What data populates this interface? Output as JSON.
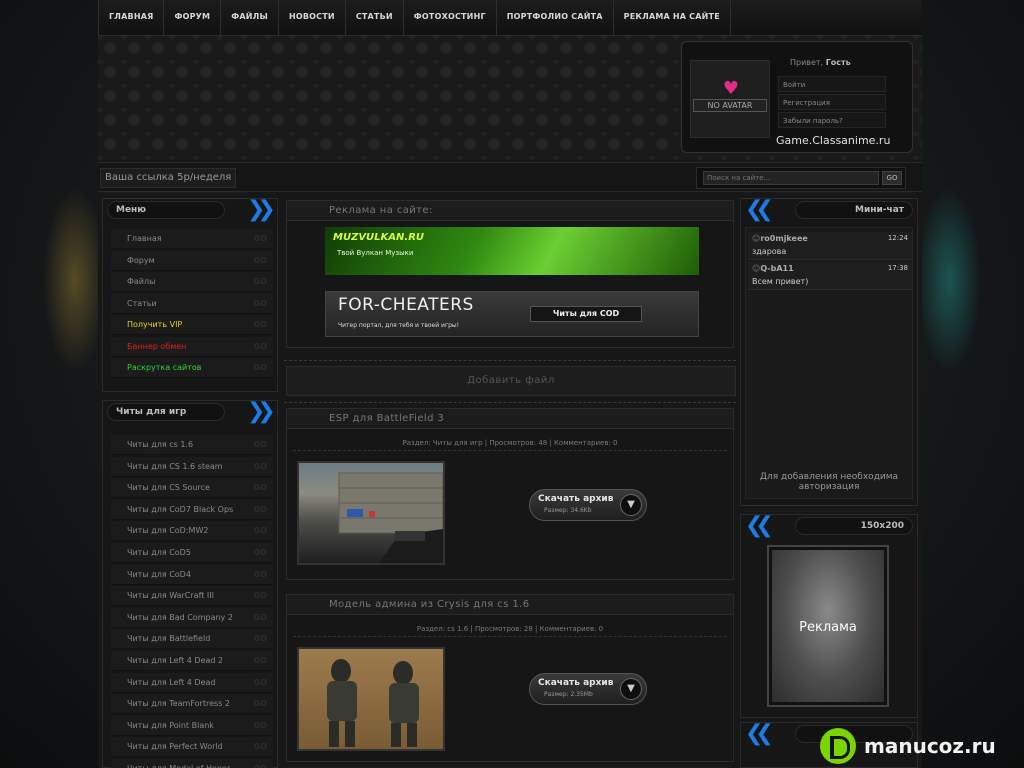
{
  "nav": [
    "ГЛАВНАЯ",
    "ФОРУМ",
    "ФАЙЛЫ",
    "НОВОСТИ",
    "СТАТЬИ",
    "ФОТОХОСТИНГ",
    "ПОРТФОЛИО САЙТА",
    "РЕКЛАМА НА САЙТЕ"
  ],
  "login": {
    "greeting": "Привет,",
    "guest": "Гость",
    "avatar_text": "NO AVATAR",
    "links": [
      "Войти",
      "Регистрация",
      "Забыли пароль?"
    ],
    "site_domain": "Game.Classanime.ru"
  },
  "linkbar": {
    "your_link": "Ваша ссылка 5р/неделя"
  },
  "search": {
    "placeholder": "Поиск на сайте...",
    "button": "GO"
  },
  "menu": {
    "title": "Меню",
    "go": "GO",
    "items": [
      {
        "label": "Главная",
        "color": "#8a8a8a"
      },
      {
        "label": "Форум",
        "color": "#8a8a8a"
      },
      {
        "label": "Файлы",
        "color": "#8a8a8a"
      },
      {
        "label": "Статьи",
        "color": "#8a8a8a"
      },
      {
        "label": "Получить VIP",
        "color": "#e6d21a"
      },
      {
        "label": "Баннер обмен",
        "color": "#e01e1e"
      },
      {
        "label": "Раскрутка сайтов",
        "color": "#2ed62e"
      }
    ]
  },
  "cheats": {
    "title": "Читы для игр",
    "items": [
      "Читы для cs 1.6",
      "Читы для CS 1.6 steam",
      "Читы для CS Source",
      "Читы для CoD7 Black Ops",
      "Читы для CoD:MW2",
      "Читы для CoD5",
      "Читы для CoD4",
      "Читы для WarCraft III",
      "Читы для Bad Company 2",
      "Читы для Battlefield",
      "Читы для Left 4 Dead 2",
      "Читы для Left 4 Dead",
      "Читы для TeamFortress 2",
      "Читы для Point Blank",
      "Читы для Perfect World",
      "Читы для Medal of Honor"
    ]
  },
  "ads": {
    "title": "Реклама на сайте:",
    "banner1_title": "MUZVULKAN.RU",
    "banner1_sub": "Твой Вулкан Музыки",
    "banner2_title": "FOR-CHEATERS",
    "banner2_sub": "Читер портал, для тебя и твоей игры!",
    "banner2_btn": "Читы для COD"
  },
  "add_file": "Добавить файл",
  "posts": [
    {
      "title": "ESP для BattleField 3",
      "meta": "Раздел: Читы для игр | Просмотров: 48 | Комментариев: 0",
      "download": "Скачать архив",
      "size": "Размер: 34.6Kb"
    },
    {
      "title": "Модель админа из Crysis для cs 1.6",
      "meta": "Раздел: cs 1.6 | Просмотров: 28 | Комментариев: 0",
      "download": "Скачать архив",
      "size": "Размер: 2.35Mb"
    }
  ],
  "chat": {
    "title": "Мини-чат",
    "messages": [
      {
        "user": "ro0mjkeee",
        "time": "12:24",
        "text": "здарова"
      },
      {
        "user": "Q-bA11",
        "time": "17:38",
        "text": "Всем привет)"
      }
    ],
    "auth_note": "Для добавления необходима авторизация"
  },
  "ad_block": {
    "title": "150x200",
    "label": "Реклама"
  },
  "watermark": "manucoz.ru"
}
